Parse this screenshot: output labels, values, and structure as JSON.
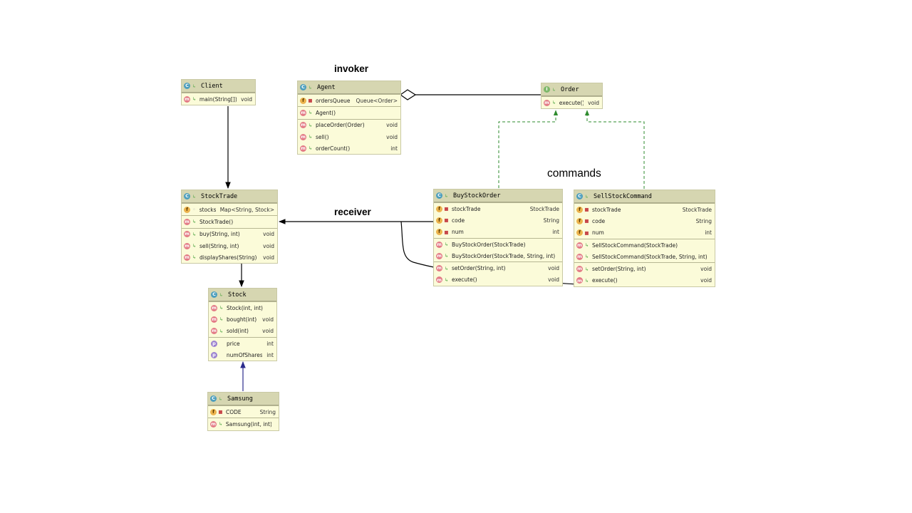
{
  "labels": {
    "invoker": "invoker",
    "commands": "commands",
    "receiver": "receiver"
  },
  "colors": {
    "class_fill": "#fbfbd9",
    "class_header": "#d6d6b1",
    "realization_edge": "#2e8b2e",
    "inheritance_edge": "#2b2b8c"
  },
  "classes": {
    "client": {
      "name": "Client",
      "kind_icon": "class-icon",
      "sections": [
        [
          {
            "icon": "m",
            "vis": "pub",
            "name": "main(String[])",
            "type": "void"
          }
        ]
      ]
    },
    "agent": {
      "name": "Agent",
      "kind_icon": "class-icon",
      "sections": [
        [
          {
            "icon": "f",
            "vis": "priv",
            "name": "ordersQueue",
            "type": "Queue<Order>"
          }
        ],
        [
          {
            "icon": "m",
            "vis": "pub",
            "name": "Agent()",
            "type": ""
          }
        ],
        [
          {
            "icon": "m",
            "vis": "pub",
            "name": "placeOrder(Order)",
            "type": "void"
          },
          {
            "icon": "m",
            "vis": "pub",
            "name": "sell()",
            "type": "void"
          },
          {
            "icon": "m",
            "vis": "pub",
            "name": "orderCount()",
            "type": "int"
          }
        ]
      ]
    },
    "order": {
      "name": "Order",
      "kind_icon": "interface-icon",
      "sections": [
        [
          {
            "icon": "m",
            "vis": "pub",
            "name": "execute()",
            "type": "void"
          }
        ]
      ]
    },
    "stocktrade": {
      "name": "StockTrade",
      "kind_icon": "class-icon",
      "sections": [
        [
          {
            "icon": "f",
            "vis": "pkg",
            "name": "stocks",
            "type": "Map<String, Stock>"
          }
        ],
        [
          {
            "icon": "m",
            "vis": "pub",
            "name": "StockTrade()",
            "type": ""
          }
        ],
        [
          {
            "icon": "m",
            "vis": "pub",
            "name": "buy(String, int)",
            "type": "void"
          },
          {
            "icon": "m",
            "vis": "pub",
            "name": "sell(String, int)",
            "type": "void"
          },
          {
            "icon": "m",
            "vis": "pub",
            "name": "displayShares(String)",
            "type": "void"
          }
        ]
      ]
    },
    "buystockorder": {
      "name": "BuyStockOrder",
      "kind_icon": "class-icon",
      "sections": [
        [
          {
            "icon": "f",
            "vis": "priv",
            "name": "stockTrade",
            "type": "StockTrade"
          },
          {
            "icon": "f",
            "vis": "priv",
            "name": "code",
            "type": "String"
          },
          {
            "icon": "f",
            "vis": "priv",
            "name": "num",
            "type": "int"
          }
        ],
        [
          {
            "icon": "m",
            "vis": "pub",
            "name": "BuyStockOrder(StockTrade)",
            "type": ""
          },
          {
            "icon": "m",
            "vis": "pub",
            "name": "BuyStockOrder(StockTrade, String, int)",
            "type": ""
          }
        ],
        [
          {
            "icon": "m",
            "vis": "pub",
            "name": "setOrder(String, int)",
            "type": "void"
          },
          {
            "icon": "m",
            "vis": "pub",
            "name": "execute()",
            "type": "void"
          }
        ]
      ]
    },
    "sellstockcommand": {
      "name": "SellStockCommand",
      "kind_icon": "class-icon",
      "sections": [
        [
          {
            "icon": "f",
            "vis": "priv",
            "name": "stockTrade",
            "type": "StockTrade"
          },
          {
            "icon": "f",
            "vis": "priv",
            "name": "code",
            "type": "String"
          },
          {
            "icon": "f",
            "vis": "priv",
            "name": "num",
            "type": "int"
          }
        ],
        [
          {
            "icon": "m",
            "vis": "pub",
            "name": "SellStockCommand(StockTrade)",
            "type": ""
          },
          {
            "icon": "m",
            "vis": "pub",
            "name": "SellStockCommand(StockTrade, String, int)",
            "type": ""
          }
        ],
        [
          {
            "icon": "m",
            "vis": "pub",
            "name": "setOrder(String, int)",
            "type": "void"
          },
          {
            "icon": "m",
            "vis": "pub",
            "name": "execute()",
            "type": "void"
          }
        ]
      ]
    },
    "stock": {
      "name": "Stock",
      "kind_icon": "class-icon",
      "sections": [
        [
          {
            "icon": "m",
            "vis": "pub",
            "name": "Stock(int, int)",
            "type": ""
          },
          {
            "icon": "m",
            "vis": "pub",
            "name": "bought(int)",
            "type": "void"
          },
          {
            "icon": "m",
            "vis": "pub",
            "name": "sold(int)",
            "type": "void"
          }
        ],
        [
          {
            "icon": "p",
            "vis": "none",
            "name": "price",
            "type": "int"
          },
          {
            "icon": "p",
            "vis": "none",
            "name": "numOfShares",
            "type": "int"
          }
        ]
      ]
    },
    "samsung": {
      "name": "Samsung",
      "kind_icon": "class-icon",
      "sections": [
        [
          {
            "icon": "f",
            "vis": "priv",
            "name": "CODE",
            "type": "String"
          }
        ],
        [
          {
            "icon": "m",
            "vis": "pub",
            "name": "Samsung(int, int)",
            "type": ""
          }
        ]
      ]
    }
  },
  "edges": [
    {
      "from": "Client",
      "to": "StockTrade",
      "kind": "dependency"
    },
    {
      "from": "StockTrade",
      "to": "Stock",
      "kind": "dependency"
    },
    {
      "from": "Samsung",
      "to": "Stock",
      "kind": "inheritance"
    },
    {
      "from": "Agent",
      "to": "Order",
      "kind": "aggregation"
    },
    {
      "from": "BuyStockOrder",
      "to": "Order",
      "kind": "realization"
    },
    {
      "from": "SellStockCommand",
      "to": "Order",
      "kind": "realization"
    },
    {
      "from": "BuyStockOrder",
      "to": "StockTrade",
      "kind": "association"
    },
    {
      "from": "SellStockCommand",
      "to": "StockTrade",
      "kind": "association"
    }
  ]
}
